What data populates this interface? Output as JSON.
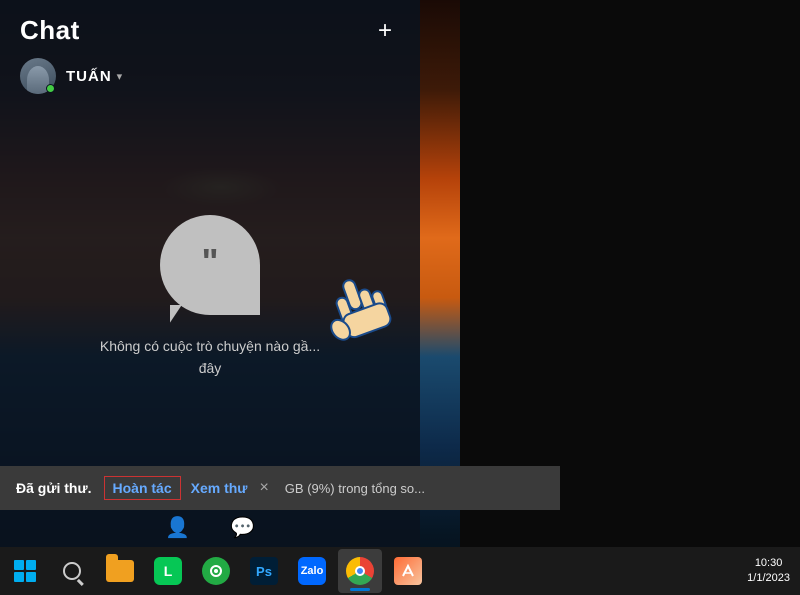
{
  "app": {
    "title": "Chat"
  },
  "header": {
    "title": "Chat",
    "add_button": "+",
    "user": {
      "name": "TUẤN",
      "dropdown": "▾",
      "status": "online"
    }
  },
  "chat_main": {
    "empty_message_line1": "Không có cuộc trò chuyện nào gầ...",
    "empty_message_line2": "đây",
    "empty_message_full": "Không có cuộc trò chuyện nào gần\nđây"
  },
  "notification": {
    "sent_label": "Đã gửi thư.",
    "undo_label": "Hoàn tác",
    "view_label": "Xem thư",
    "close_label": "×",
    "storage_text": "GB (9%) trong tổng so..."
  },
  "tabs": {
    "people_icon": "👤",
    "chat_icon": "💬"
  },
  "taskbar": {
    "apps": [
      {
        "name": "File Explorer",
        "type": "folder"
      },
      {
        "name": "LINE",
        "type": "line"
      },
      {
        "name": "Groove Music",
        "type": "green"
      },
      {
        "name": "Photoshop",
        "type": "ps"
      },
      {
        "name": "Zalo",
        "type": "zalo"
      },
      {
        "name": "Chrome",
        "type": "chrome"
      },
      {
        "name": "Paint",
        "type": "paint"
      }
    ]
  }
}
